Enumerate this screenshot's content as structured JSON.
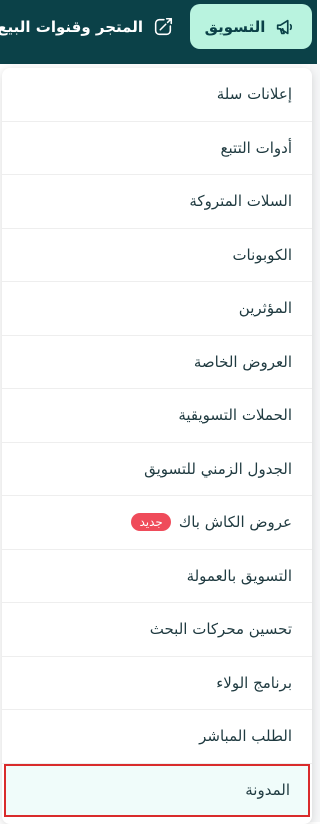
{
  "topbar": {
    "marketing_label": "التسويق",
    "store_label": "المتجر وقنوات البيع",
    "colors": {
      "background": "#0b4148",
      "active_tab": "#b9f3df"
    }
  },
  "menu": {
    "items": [
      {
        "label": "إعلانات سلة"
      },
      {
        "label": "أدوات التتبع"
      },
      {
        "label": "السلات المتروكة"
      },
      {
        "label": "الكوبونات"
      },
      {
        "label": "المؤثرين"
      },
      {
        "label": "العروض الخاصة"
      },
      {
        "label": "الحملات التسويقية"
      },
      {
        "label": "الجدول الزمني للتسويق"
      },
      {
        "label": "عروض الكاش باك",
        "badge": "جديد"
      },
      {
        "label": "التسويق بالعمولة"
      },
      {
        "label": "تحسين محركات البحث"
      },
      {
        "label": "برنامج الولاء"
      },
      {
        "label": "الطلب المباشر"
      },
      {
        "label": "المدونة"
      }
    ],
    "badge_color": "#ef4b5a",
    "highlight_color": "#d92b2b"
  }
}
